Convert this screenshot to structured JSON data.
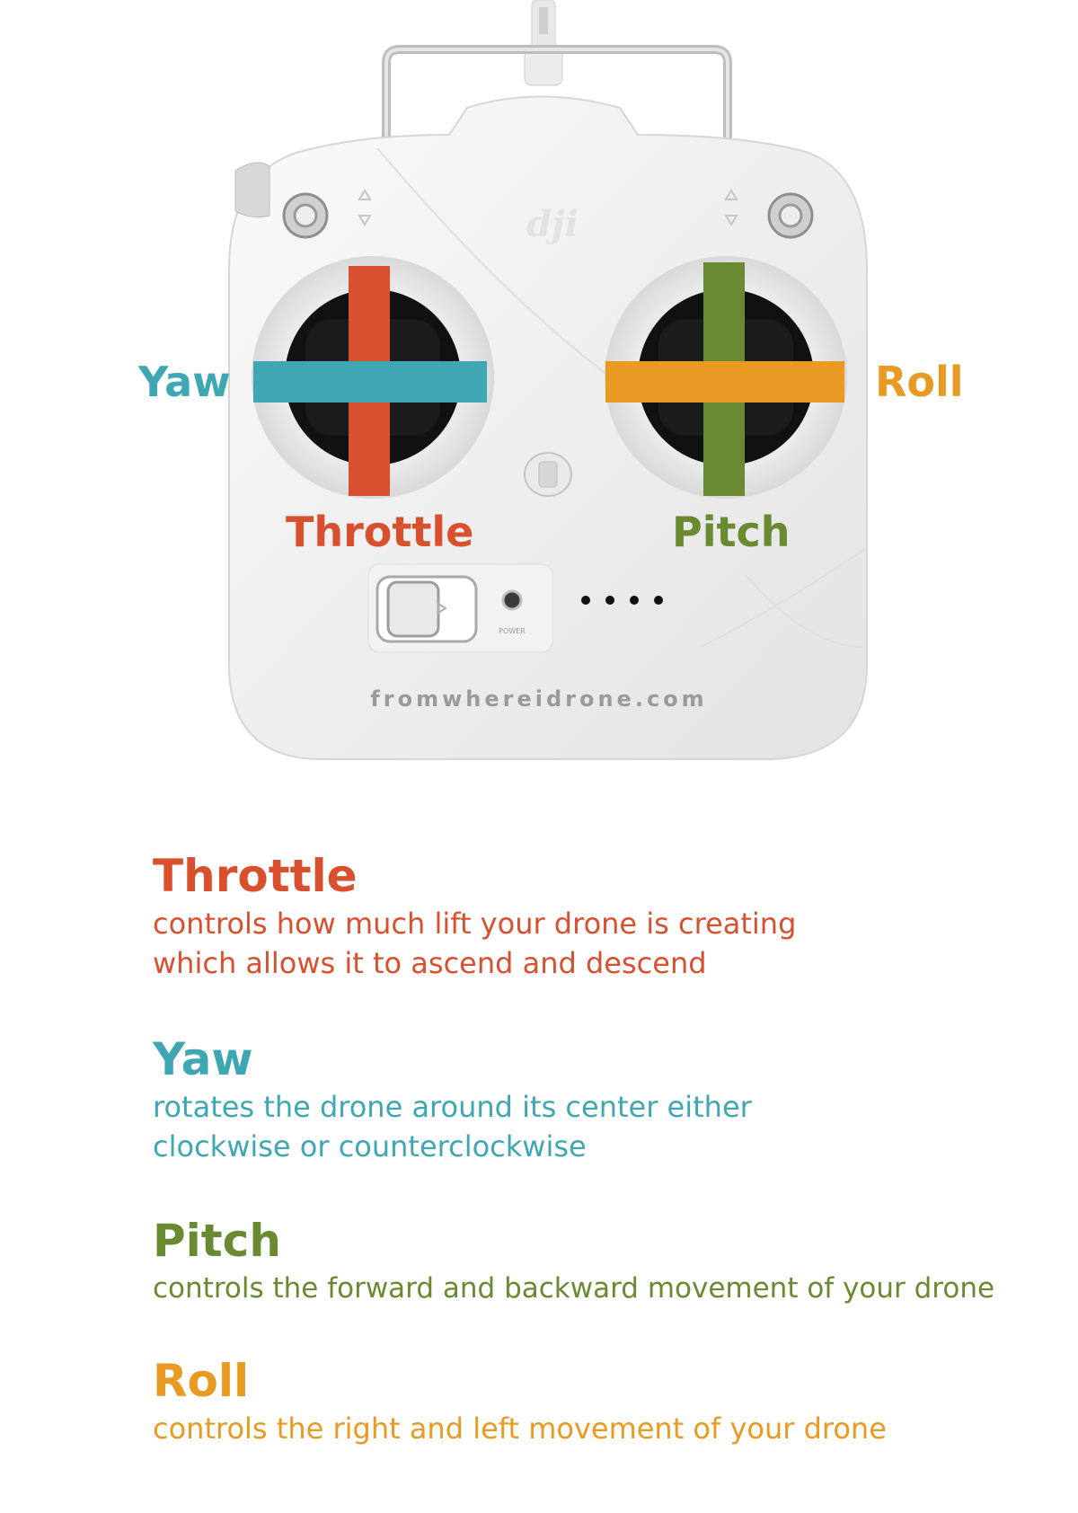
{
  "colors": {
    "throttle": "#d9502f",
    "yaw": "#3fa7b3",
    "pitch": "#6a8a32",
    "roll": "#e89a22",
    "controller_body": "#efefef",
    "stick_well": "#111111"
  },
  "diagram": {
    "labels": {
      "yaw": "Yaw",
      "roll": "Roll",
      "throttle": "Throttle",
      "pitch": "Pitch"
    },
    "brand_logo": "dji",
    "power_label": "POWER",
    "watermark": "fromwhereidrone.com"
  },
  "descriptions": [
    {
      "key": "throttle",
      "title": "Throttle",
      "text": "controls how much lift your drone is creating\nwhich allows it to ascend and descend"
    },
    {
      "key": "yaw",
      "title": "Yaw",
      "text": "rotates the drone around its center either\nclockwise or counterclockwise"
    },
    {
      "key": "pitch",
      "title": "Pitch",
      "text": "controls the forward and backward movement of your drone"
    },
    {
      "key": "roll",
      "title": "Roll",
      "text": "controls the right and left movement of your drone"
    }
  ]
}
